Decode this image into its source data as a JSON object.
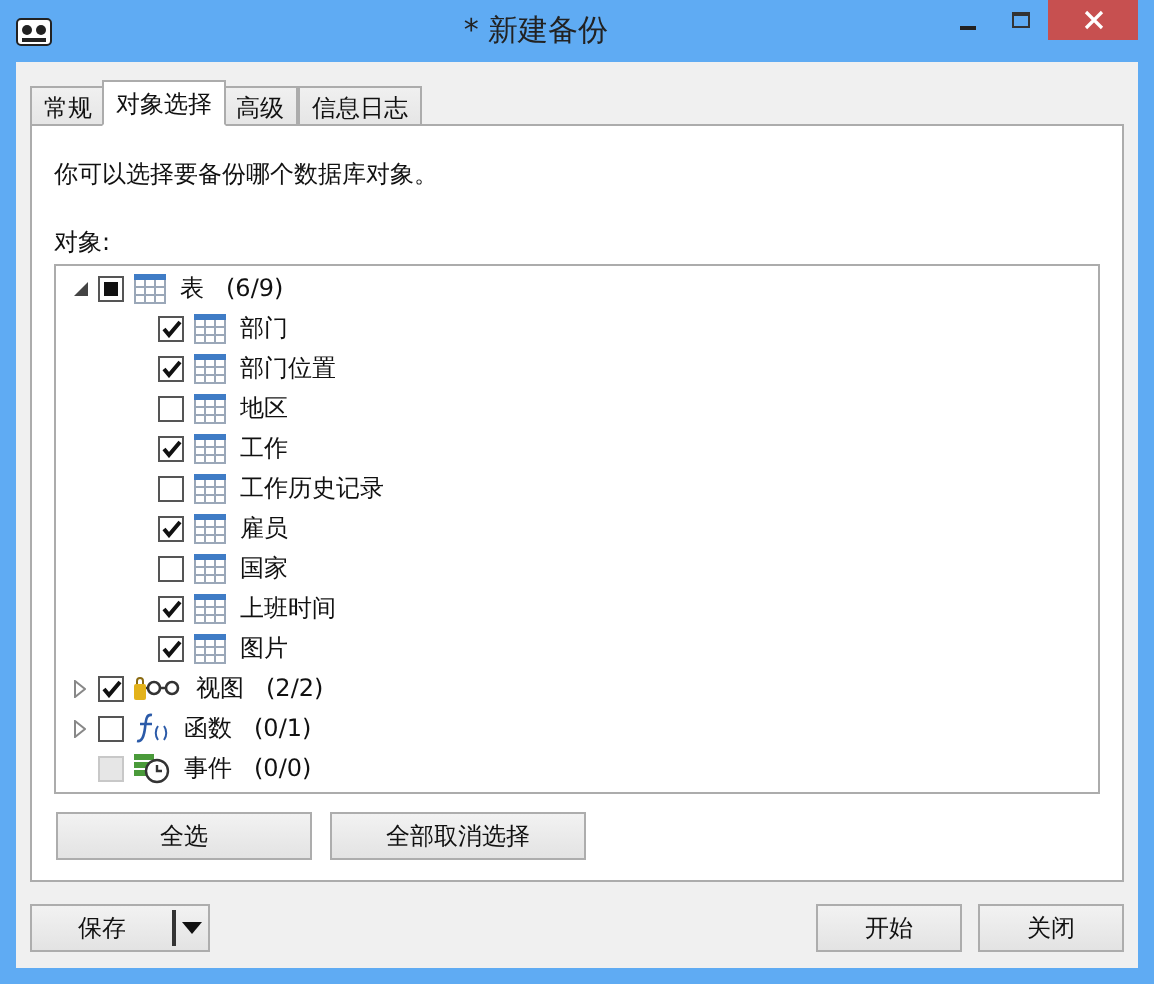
{
  "window": {
    "title": "* 新建备份"
  },
  "tabs": [
    {
      "label": "常规",
      "selected": false
    },
    {
      "label": "对象选择",
      "selected": true
    },
    {
      "label": "高级",
      "selected": false
    },
    {
      "label": "信息日志",
      "selected": false
    }
  ],
  "description": "你可以选择要备份哪个数据库对象。",
  "objects_label": "对象:",
  "tree": [
    {
      "label": "表",
      "count": "(6/9)",
      "kind": "table",
      "checked": false,
      "partial": true,
      "disabled": false,
      "expanded": true,
      "children": [
        {
          "label": "部门",
          "kind": "table",
          "checked": true,
          "disabled": false
        },
        {
          "label": "部门位置",
          "kind": "table",
          "checked": true,
          "disabled": false
        },
        {
          "label": "地区",
          "kind": "table",
          "checked": false,
          "disabled": false
        },
        {
          "label": "工作",
          "kind": "table",
          "checked": true,
          "disabled": false
        },
        {
          "label": "工作历史记录",
          "kind": "table",
          "checked": false,
          "disabled": false
        },
        {
          "label": "雇员",
          "kind": "table",
          "checked": true,
          "disabled": false
        },
        {
          "label": "国家",
          "kind": "table",
          "checked": false,
          "disabled": false
        },
        {
          "label": "上班时间",
          "kind": "table",
          "checked": true,
          "disabled": false
        },
        {
          "label": "图片",
          "kind": "table",
          "checked": true,
          "disabled": false
        }
      ]
    },
    {
      "label": "视图",
      "count": "(2/2)",
      "kind": "view",
      "checked": true,
      "partial": false,
      "disabled": false,
      "expanded": false
    },
    {
      "label": "函数",
      "count": "(0/1)",
      "kind": "function",
      "checked": false,
      "partial": false,
      "disabled": false,
      "expanded": false
    },
    {
      "label": "事件",
      "count": "(0/0)",
      "kind": "event",
      "checked": false,
      "partial": false,
      "disabled": true
    }
  ],
  "select_buttons": [
    "全选",
    "全部取消选择"
  ],
  "save_button": "保存",
  "action_buttons": [
    "开始",
    "关闭"
  ]
}
